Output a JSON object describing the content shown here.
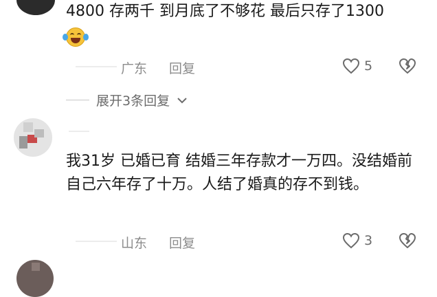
{
  "comments": [
    {
      "text": "4800 存两千 到月底了不够花 最后只存了1300",
      "emoji": "laugh-cry-emoji",
      "region": "广东",
      "reply_label": "回复",
      "likes": "5"
    },
    {
      "text": "我31岁 已婚已育 结婚三年存款才一万四。没结婚前自己六年存了十万。人结了婚真的存不到钱。",
      "region": "山东",
      "reply_label": "回复",
      "likes": "3"
    }
  ],
  "expand_replies": "展开3条回复",
  "colors": {
    "meta": "#8c8c8c",
    "text": "#1a1a1a",
    "icon": "#6b6b6b"
  }
}
